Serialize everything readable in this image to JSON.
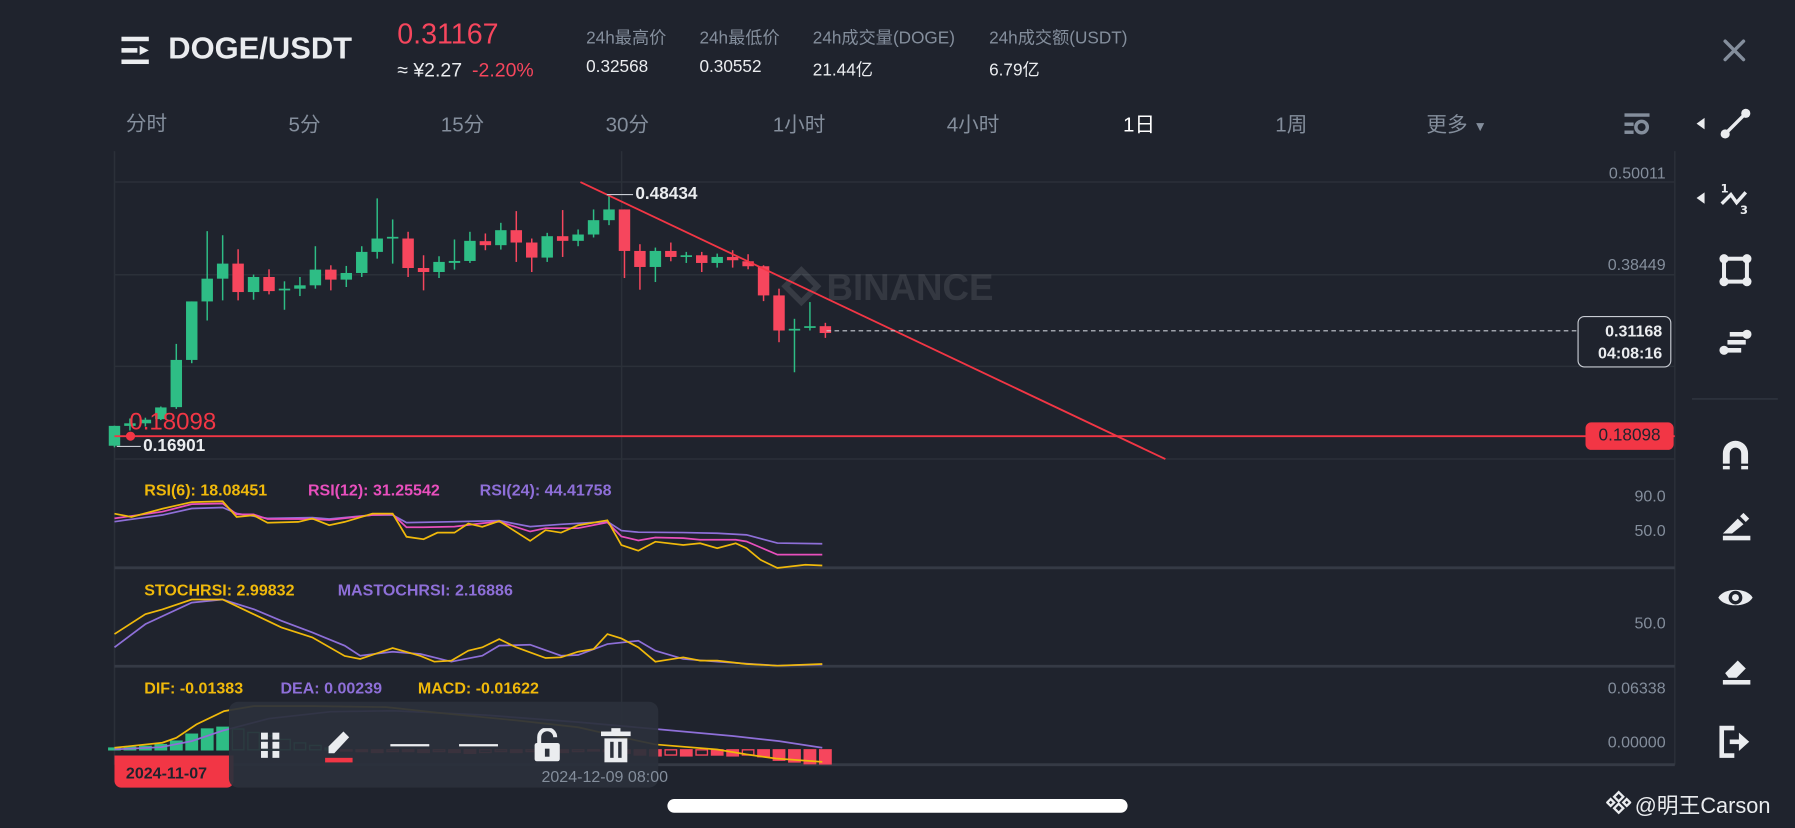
{
  "header": {
    "pair": "DOGE/USDT",
    "last_price": "0.31167",
    "cny_price": "≈ ¥2.27",
    "change_pct": "-2.20%",
    "stats": [
      {
        "label": "24h最高价",
        "value": "0.32568"
      },
      {
        "label": "24h最低价",
        "value": "0.30552"
      },
      {
        "label": "24h成交量(DOGE)",
        "value": "21.44亿"
      },
      {
        "label": "24h成交额(USDT)",
        "value": "6.79亿"
      }
    ]
  },
  "timeframes": [
    {
      "label": "分时"
    },
    {
      "label": "5分"
    },
    {
      "label": "15分"
    },
    {
      "label": "30分"
    },
    {
      "label": "1小时"
    },
    {
      "label": "4小时"
    },
    {
      "label": "1日",
      "active": true
    },
    {
      "label": "1周"
    },
    {
      "label": "更多"
    }
  ],
  "colors": {
    "up": "#2ebd85",
    "down": "#f6465d",
    "rsi6": "#f0b90b",
    "rsi12": "#e84fbd",
    "rsi24": "#8e6fd8",
    "background": "#1f232d"
  },
  "watermark": "BINANCE",
  "price_axis": {
    "labels": [
      "0.50011",
      "0.38449"
    ],
    "current_price": "0.31168",
    "countdown": "04:08:16",
    "line_price_label": "0.18098"
  },
  "annotations": {
    "high_label": "0.48434",
    "low_label": "0.16901",
    "hline_price": "0.18098"
  },
  "chart_data": {
    "type": "candlestick",
    "interval": "1日",
    "y_axis_ticks": [
      0.50011,
      0.38449
    ],
    "candles": [
      {
        "o": 0.171,
        "h": 0.196,
        "l": 0.16901,
        "c": 0.1958
      },
      {
        "o": 0.1958,
        "h": 0.205,
        "l": 0.19,
        "c": 0.199
      },
      {
        "o": 0.199,
        "h": 0.206,
        "l": 0.195,
        "c": 0.2035
      },
      {
        "o": 0.2042,
        "h": 0.22,
        "l": 0.203,
        "c": 0.2188
      },
      {
        "o": 0.2192,
        "h": 0.2981,
        "l": 0.217,
        "c": 0.2781
      },
      {
        "o": 0.2781,
        "h": 0.3511,
        "l": 0.274,
        "c": 0.3511
      },
      {
        "o": 0.3511,
        "h": 0.4388,
        "l": 0.3273,
        "c": 0.3795
      },
      {
        "o": 0.3795,
        "h": 0.4337,
        "l": 0.3524,
        "c": 0.3983
      },
      {
        "o": 0.3983,
        "h": 0.4162,
        "l": 0.3524,
        "c": 0.3628
      },
      {
        "o": 0.3628,
        "h": 0.3846,
        "l": 0.3532,
        "c": 0.3816
      },
      {
        "o": 0.3816,
        "h": 0.3912,
        "l": 0.3599,
        "c": 0.364
      },
      {
        "o": 0.365,
        "h": 0.3762,
        "l": 0.3407,
        "c": 0.367
      },
      {
        "o": 0.367,
        "h": 0.3816,
        "l": 0.3578,
        "c": 0.3712
      },
      {
        "o": 0.3712,
        "h": 0.42,
        "l": 0.367,
        "c": 0.3908
      },
      {
        "o": 0.3908,
        "h": 0.3962,
        "l": 0.3649,
        "c": 0.3783
      },
      {
        "o": 0.3783,
        "h": 0.3954,
        "l": 0.3691,
        "c": 0.3866
      },
      {
        "o": 0.3866,
        "h": 0.42,
        "l": 0.3816,
        "c": 0.4129
      },
      {
        "o": 0.4129,
        "h": 0.4797,
        "l": 0.4045,
        "c": 0.4296
      },
      {
        "o": 0.43,
        "h": 0.4534,
        "l": 0.3983,
        "c": 0.4317
      },
      {
        "o": 0.4296,
        "h": 0.438,
        "l": 0.3816,
        "c": 0.3928
      },
      {
        "o": 0.3928,
        "h": 0.4087,
        "l": 0.3649,
        "c": 0.3878
      },
      {
        "o": 0.3878,
        "h": 0.4075,
        "l": 0.3803,
        "c": 0.4004
      },
      {
        "o": 0.3992,
        "h": 0.4284,
        "l": 0.3908,
        "c": 0.4016
      },
      {
        "o": 0.4016,
        "h": 0.438,
        "l": 0.3991,
        "c": 0.4267
      },
      {
        "o": 0.4263,
        "h": 0.4359,
        "l": 0.415,
        "c": 0.4213
      },
      {
        "o": 0.4213,
        "h": 0.4492,
        "l": 0.4158,
        "c": 0.44
      },
      {
        "o": 0.44,
        "h": 0.4638,
        "l": 0.4004,
        "c": 0.4246
      },
      {
        "o": 0.4246,
        "h": 0.4296,
        "l": 0.3878,
        "c": 0.4058
      },
      {
        "o": 0.4058,
        "h": 0.4367,
        "l": 0.4004,
        "c": 0.4325
      },
      {
        "o": 0.4325,
        "h": 0.4651,
        "l": 0.4066,
        "c": 0.4267
      },
      {
        "o": 0.4267,
        "h": 0.4409,
        "l": 0.42,
        "c": 0.4346
      },
      {
        "o": 0.4346,
        "h": 0.4659,
        "l": 0.4309,
        "c": 0.4525
      },
      {
        "o": 0.4525,
        "h": 0.48434,
        "l": 0.4463,
        "c": 0.4659
      },
      {
        "o": 0.4659,
        "h": 0.4659,
        "l": 0.3803,
        "c": 0.4141
      },
      {
        "o": 0.4141,
        "h": 0.4225,
        "l": 0.3657,
        "c": 0.3941
      },
      {
        "o": 0.3941,
        "h": 0.4183,
        "l": 0.3753,
        "c": 0.4141
      },
      {
        "o": 0.4141,
        "h": 0.4246,
        "l": 0.4012,
        "c": 0.4066
      },
      {
        "o": 0.4066,
        "h": 0.4129,
        "l": 0.3991,
        "c": 0.4087
      },
      {
        "o": 0.4087,
        "h": 0.4129,
        "l": 0.3878,
        "c": 0.3991
      },
      {
        "o": 0.3991,
        "h": 0.4108,
        "l": 0.3933,
        "c": 0.4066
      },
      {
        "o": 0.4066,
        "h": 0.415,
        "l": 0.3933,
        "c": 0.4025
      },
      {
        "o": 0.4012,
        "h": 0.41,
        "l": 0.3912,
        "c": 0.395
      },
      {
        "o": 0.395,
        "h": 0.3962,
        "l": 0.3515,
        "c": 0.3586
      },
      {
        "o": 0.3586,
        "h": 0.367,
        "l": 0.3002,
        "c": 0.3148
      },
      {
        "o": 0.3148,
        "h": 0.3294,
        "l": 0.2627,
        "c": 0.3169
      },
      {
        "o": 0.3181,
        "h": 0.3503,
        "l": 0.3148,
        "c": 0.3202
      },
      {
        "o": 0.3202,
        "h": 0.3244,
        "l": 0.3056,
        "c": 0.31168
      }
    ],
    "rsi": {
      "legend": [
        "RSI(6): 18.08451",
        "RSI(12): 31.25542",
        "RSI(24): 44.41758"
      ],
      "ticks": [
        "90.0",
        "50.0"
      ],
      "rsi6": [
        [
          0,
          81
        ],
        [
          1.1,
          77
        ],
        [
          3.1,
          87
        ],
        [
          5,
          95
        ],
        [
          7,
          96
        ],
        [
          7.9,
          77
        ],
        [
          9,
          79
        ],
        [
          9.9,
          70
        ],
        [
          11.9,
          71
        ],
        [
          12.8,
          75
        ],
        [
          13.9,
          67
        ],
        [
          14.9,
          71
        ],
        [
          16.7,
          81
        ],
        [
          18,
          81
        ],
        [
          18.9,
          53
        ],
        [
          20,
          50
        ],
        [
          20.9,
          58
        ],
        [
          22,
          58
        ],
        [
          22.9,
          69
        ],
        [
          23.8,
          65
        ],
        [
          24.9,
          72
        ],
        [
          26.9,
          48
        ],
        [
          27.9,
          61
        ],
        [
          28.9,
          58
        ],
        [
          30,
          67
        ],
        [
          31.9,
          73
        ],
        [
          32.8,
          43
        ],
        [
          33.9,
          36
        ],
        [
          35,
          47
        ],
        [
          36.8,
          43
        ],
        [
          37.9,
          45
        ],
        [
          39,
          39
        ],
        [
          40.2,
          45
        ],
        [
          40.9,
          39
        ],
        [
          41.8,
          25
        ],
        [
          42.9,
          15
        ],
        [
          44.7,
          19
        ],
        [
          45.8,
          18.08
        ]
      ],
      "rsi12": [
        [
          0,
          75.3
        ],
        [
          3.1,
          83.3
        ],
        [
          5,
          92.5
        ],
        [
          7,
          93.3
        ],
        [
          7.9,
          80.1
        ],
        [
          9,
          80.1
        ],
        [
          9.9,
          74.5
        ],
        [
          12.8,
          74.5
        ],
        [
          13.9,
          73.3
        ],
        [
          16.7,
          79.3
        ],
        [
          18,
          80.1
        ],
        [
          18.9,
          64.5
        ],
        [
          20,
          64.5
        ],
        [
          22,
          65.3
        ],
        [
          23.8,
          69.3
        ],
        [
          24.9,
          71.3
        ],
        [
          26.9,
          59.3
        ],
        [
          27.9,
          63.3
        ],
        [
          30,
          63.3
        ],
        [
          31.9,
          70.5
        ],
        [
          32.8,
          53.3
        ],
        [
          33.9,
          48.5
        ],
        [
          35,
          52.1
        ],
        [
          36.8,
          51.3
        ],
        [
          37.9,
          49.3
        ],
        [
          40.2,
          49.3
        ],
        [
          40.9,
          47.3
        ],
        [
          42.9,
          31.3
        ],
        [
          45.8,
          31.26
        ]
      ],
      "rsi24": [
        [
          0,
          71.3
        ],
        [
          3.1,
          79.3
        ],
        [
          5,
          87.3
        ],
        [
          7,
          88.5
        ],
        [
          7.9,
          81.3
        ],
        [
          9.9,
          75.3
        ],
        [
          12.8,
          76.1
        ],
        [
          13.9,
          74.5
        ],
        [
          16.7,
          79.3
        ],
        [
          18,
          79.3
        ],
        [
          18.9,
          70.1
        ],
        [
          22,
          71.3
        ],
        [
          24.9,
          72.5
        ],
        [
          26.9,
          65.3
        ],
        [
          28.9,
          68.1
        ],
        [
          31.9,
          71.3
        ],
        [
          32.8,
          60.5
        ],
        [
          33.9,
          58.5
        ],
        [
          36.8,
          58.1
        ],
        [
          39,
          57.3
        ],
        [
          40.9,
          55.3
        ],
        [
          42.9,
          45.3
        ],
        [
          45.8,
          44.42
        ]
      ]
    },
    "stochrsi": {
      "legend": [
        "STOCHRSI: 2.99832",
        "MASTOCHRSI: 2.16886"
      ],
      "ticks": [
        "50.0"
      ],
      "stoch": [
        [
          0,
          48
        ],
        [
          2,
          78
        ],
        [
          3.1,
          85
        ],
        [
          5,
          100
        ],
        [
          7,
          100
        ],
        [
          9,
          78
        ],
        [
          10.8,
          58
        ],
        [
          12.8,
          43
        ],
        [
          14.9,
          15
        ],
        [
          15.9,
          10.5
        ],
        [
          18,
          27
        ],
        [
          19.8,
          15
        ],
        [
          20.7,
          6.5
        ],
        [
          21.8,
          8
        ],
        [
          22.9,
          23
        ],
        [
          23.8,
          28
        ],
        [
          24.9,
          40.5
        ],
        [
          26,
          28
        ],
        [
          27.9,
          12
        ],
        [
          28.9,
          13
        ],
        [
          30,
          21.5
        ],
        [
          31,
          25.5
        ],
        [
          31.9,
          48
        ],
        [
          32.8,
          41.5
        ],
        [
          33.9,
          28
        ],
        [
          35,
          6.5
        ],
        [
          36.8,
          13
        ],
        [
          37.9,
          8
        ],
        [
          39,
          8
        ],
        [
          40.9,
          3
        ],
        [
          42.9,
          0.5
        ],
        [
          45.8,
          3
        ]
      ],
      "ma": [
        [
          0,
          28
        ],
        [
          2,
          63
        ],
        [
          5,
          95.5
        ],
        [
          7,
          100
        ],
        [
          9,
          85.5
        ],
        [
          10.8,
          68
        ],
        [
          12.8,
          50.5
        ],
        [
          14.9,
          30.5
        ],
        [
          15.9,
          15.5
        ],
        [
          18,
          21.5
        ],
        [
          19.8,
          18
        ],
        [
          21.8,
          6.5
        ],
        [
          23.8,
          15.5
        ],
        [
          24.9,
          30.5
        ],
        [
          26.9,
          32
        ],
        [
          28.9,
          15.5
        ],
        [
          30,
          16.5
        ],
        [
          31.9,
          33
        ],
        [
          33.9,
          38
        ],
        [
          35,
          23
        ],
        [
          36.8,
          10.5
        ],
        [
          39,
          6.5
        ],
        [
          42.9,
          0.5
        ],
        [
          45.8,
          2.2
        ]
      ]
    },
    "macd": {
      "legend": [
        "DIF: -0.01383",
        "DEA: 0.00239",
        "MACD: -0.01622"
      ],
      "ticks": [
        "0.06338",
        "0.00000"
      ],
      "dif": [
        [
          0,
          0.0024
        ],
        [
          3.1,
          0.0082
        ],
        [
          4,
          0.0139
        ],
        [
          5.3,
          0.0293
        ],
        [
          7.1,
          0.0447
        ],
        [
          9,
          0.0505
        ],
        [
          13,
          0.0505
        ],
        [
          17.6,
          0.0493
        ],
        [
          21,
          0.0427
        ],
        [
          26,
          0.034
        ],
        [
          30,
          0.026
        ],
        [
          33,
          0.0139
        ],
        [
          35,
          0.0062
        ],
        [
          39,
          0.0004
        ],
        [
          40.9,
          -0.0053
        ],
        [
          42.8,
          -0.01
        ],
        [
          45.8,
          -0.01383
        ]
      ],
      "dea": [
        [
          0,
          0.0005
        ],
        [
          3,
          0.003
        ],
        [
          5,
          0.01
        ],
        [
          7,
          0.022
        ],
        [
          10,
          0.036
        ],
        [
          14,
          0.044
        ],
        [
          18,
          0.045
        ],
        [
          24,
          0.04
        ],
        [
          30,
          0.032
        ],
        [
          35,
          0.024
        ],
        [
          40,
          0.016
        ],
        [
          43,
          0.01
        ],
        [
          45.8,
          0.00239
        ]
      ],
      "hist": [
        0.002,
        0.003,
        0.004,
        0.006,
        0.01,
        0.018,
        0.024,
        0.026,
        0.024,
        0.02,
        0.016,
        0.012,
        0.008,
        0.005,
        0.002,
        -0.001,
        -0.002,
        -0.003,
        -0.002,
        -0.002,
        -0.003,
        -0.002,
        -0.003,
        -0.004,
        -0.003,
        -0.002,
        -0.003,
        -0.002,
        -0.002,
        -0.003,
        -0.002,
        -0.001,
        -0.002,
        -0.004,
        -0.006,
        -0.007,
        -0.006,
        -0.007,
        -0.006,
        -0.006,
        -0.007,
        -0.006,
        -0.008,
        -0.012,
        -0.014,
        -0.016,
        -0.01622
      ]
    },
    "x_labels": {
      "cursor_date": "2024-11-07",
      "axis_date": "2024-12-09 08:00"
    }
  },
  "footer": {
    "watermark_handle": "@明王Carson"
  }
}
